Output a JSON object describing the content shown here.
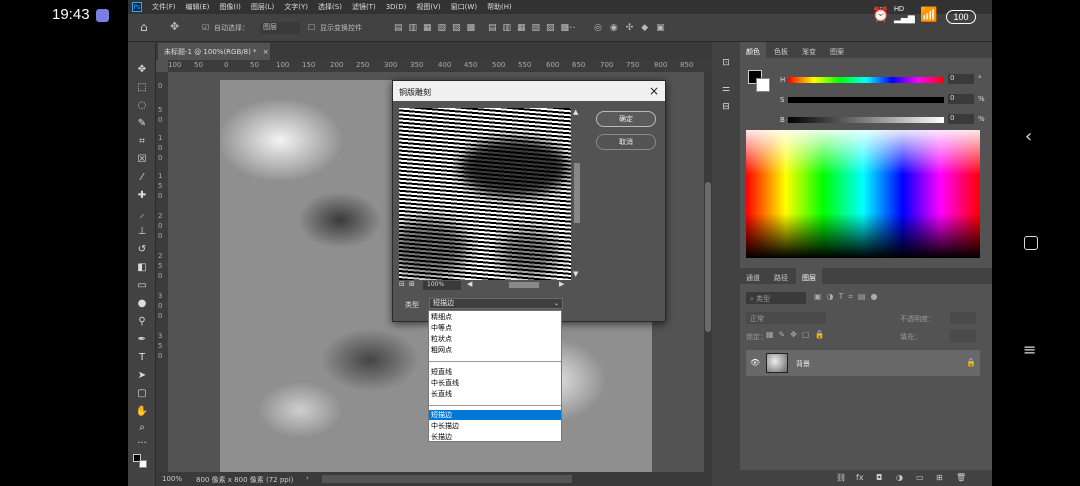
{
  "phone": {
    "time": "19:43",
    "battery": "100",
    "network": "HD"
  },
  "menu": {
    "items": [
      "文件(F)",
      "编辑(E)",
      "图像(I)",
      "图层(L)",
      "文字(Y)",
      "选择(S)",
      "滤镜(T)",
      "3D(D)",
      "视图(V)",
      "窗口(W)",
      "帮助(H)"
    ]
  },
  "options": {
    "auto_select": "自动选择：",
    "layer_mode": "图层",
    "show_transform": "显示变换控件"
  },
  "document": {
    "tab_title": "未标题-1 @ 100%(RGB/8) *",
    "ruler_h": [
      "100",
      "50",
      "0",
      "50",
      "100",
      "150",
      "200",
      "250",
      "300",
      "350",
      "400",
      "450",
      "500",
      "550",
      "600",
      "650",
      "700",
      "750",
      "800",
      "850"
    ],
    "ruler_v": [
      "0",
      "5",
      "0",
      "1",
      "0",
      "0",
      "1",
      "5",
      "0",
      "2",
      "0",
      "0",
      "2",
      "5",
      "0",
      "3",
      "0",
      "0",
      "3",
      "5",
      "0"
    ],
    "zoom": "100%",
    "size_info": "800 像素 x 800 像素 (72 ppi)"
  },
  "dialog": {
    "title": "铜版雕刻",
    "ok_label": "确定",
    "cancel_label": "取消",
    "zoom": "100%",
    "type_label": "类型",
    "type_value": "短描边"
  },
  "dropdown": {
    "group1": [
      "精细点",
      "中等点",
      "粒状点",
      "粗网点"
    ],
    "group2": [
      "短直线",
      "中长直线",
      "长直线"
    ],
    "group3": [
      "短描边",
      "中长描边",
      "长描边"
    ],
    "selected": "短描边"
  },
  "color_panel": {
    "tabs": [
      "颜色",
      "色板",
      "渐变",
      "图案"
    ],
    "sliders": [
      {
        "label": "H",
        "value": "0",
        "unit": "°"
      },
      {
        "label": "S",
        "value": "0",
        "unit": "%"
      },
      {
        "label": "B",
        "value": "0",
        "unit": "%"
      }
    ]
  },
  "layers_panel": {
    "tabs": [
      "通道",
      "路径",
      "图层"
    ],
    "filter_kind": "类型",
    "blend_mode": "正常",
    "opacity_label": "不透明度：",
    "lock_label": "锁定：",
    "fill_label": "填充：",
    "layer_name": "背景"
  }
}
